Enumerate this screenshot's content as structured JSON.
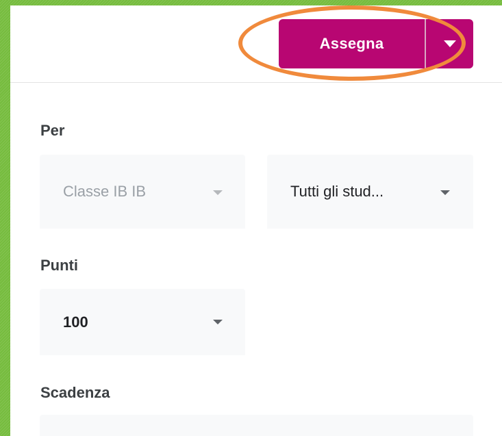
{
  "header": {
    "assign_label": "Assegna",
    "assign_menu_icon": "caret-down-icon"
  },
  "form": {
    "for_label": "Per",
    "class_select": {
      "value": "Classe IB IB",
      "disabled": true
    },
    "students_select": {
      "value": "Tutti gli stud..."
    },
    "points_label": "Punti",
    "points_select": {
      "value": "100"
    },
    "due_label": "Scadenza"
  },
  "colors": {
    "accent": "#b80672",
    "highlight_ring": "#f08a3c",
    "outer_background": "#76bc3e"
  }
}
